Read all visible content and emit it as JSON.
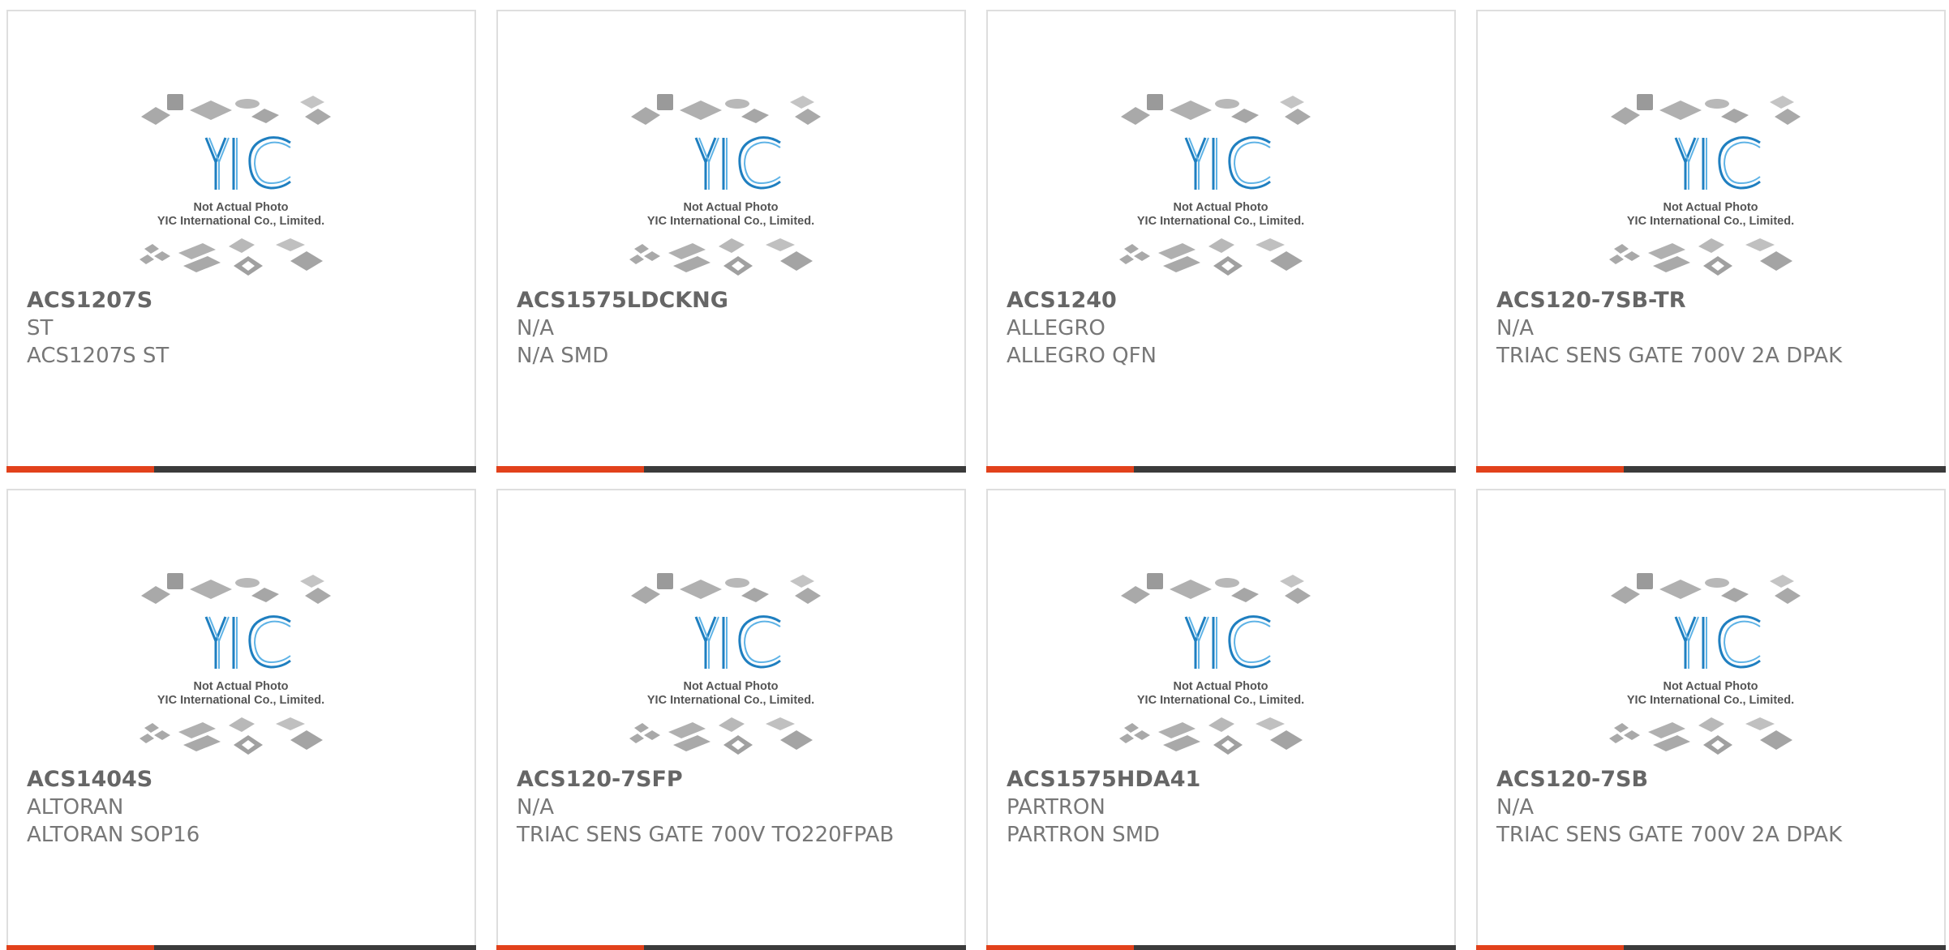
{
  "colors": {
    "accent": "#e2411b",
    "bar": "#3b3b3b",
    "logo_blue": "#1f7fc0",
    "border": "#dedede"
  },
  "placeholder": {
    "line1": "Not Actual Photo",
    "line2": "YIC International Co., Limited.",
    "logo_text": "YIC"
  },
  "products": [
    {
      "part": "ACS1207S",
      "maker": "ST",
      "desc": "ACS1207S ST"
    },
    {
      "part": "ACS1575LDCKNG",
      "maker": "N/A",
      "desc": "N/A SMD"
    },
    {
      "part": "ACS1240",
      "maker": "ALLEGRO",
      "desc": "ALLEGRO QFN"
    },
    {
      "part": "ACS120-7SB-TR",
      "maker": "N/A",
      "desc": "TRIAC SENS GATE 700V 2A DPAK"
    },
    {
      "part": "ACS1404S",
      "maker": "ALTORAN",
      "desc": "ALTORAN SOP16"
    },
    {
      "part": "ACS120-7SFP",
      "maker": "N/A",
      "desc": "TRIAC SENS GATE 700V TO220FPAB"
    },
    {
      "part": "ACS1575HDA41",
      "maker": "PARTRON",
      "desc": "PARTRON SMD"
    },
    {
      "part": "ACS120-7SB",
      "maker": "N/A",
      "desc": "TRIAC SENS GATE 700V 2A DPAK"
    }
  ]
}
